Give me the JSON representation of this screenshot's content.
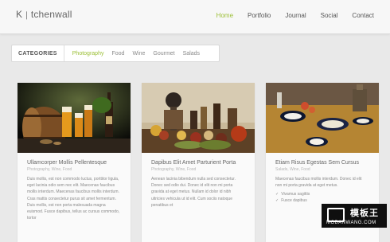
{
  "header": {
    "logo_text_start": "K",
    "logo_text_end": "tchenwall",
    "nav": {
      "home": "Home",
      "portfolio": "Portfolio",
      "journal": "Journal",
      "social": "Social",
      "contact": "Contact"
    }
  },
  "filters": {
    "title": "CATEGORIES",
    "photography": "Photography",
    "food": "Food",
    "wine": "Wine",
    "gourmet": "Gourmet",
    "salads": "Salads"
  },
  "cards": [
    {
      "title": "Ullamcorper Mollis Pellentesque",
      "meta": "Photography, Wine, Food",
      "excerpt": "Duis mollis, est non commodo luctus, porttitor ligula, eget lacinia odio sem nec elit. Maecenas faucibus mollis interdum. Maecenas faucibus mollis interdum. Cras mattis consectetur purus sit amet fermentum. Duis mollis, est non porta malesuada magna euismod. Fusce dapibus, tellus ac cursus commodo, tortor"
    },
    {
      "title": "Dapibus Elit Amet Parturient Porta",
      "meta": "Photography, Wine, Food",
      "excerpt": "Aenean lacinia bibendum nulla sed consectetur. Donec sed odio dui. Donec id elit non mi porta gravida at eget metus. Nullam id dolor id nibh ultricies vehicula ut id elit. Cum sociis natoque penatibus et"
    },
    {
      "title": "Etiam Risus Egestas Sem Cursus",
      "meta": "Salads, Wine, Food",
      "excerpt": "Maecenas faucibus mollis interdum. Donec id elit non mi porta gravida at eget metus.",
      "bullets": [
        "Vivamus sagittis",
        "Fusce dapibus"
      ]
    }
  ],
  "watermark": {
    "top": "模板王",
    "bottom": "MOBANWANG.COM"
  },
  "colors": {
    "accent": "#9bbf35",
    "page_bg": "#e9e9e9",
    "card_bg": "#fafafa"
  }
}
